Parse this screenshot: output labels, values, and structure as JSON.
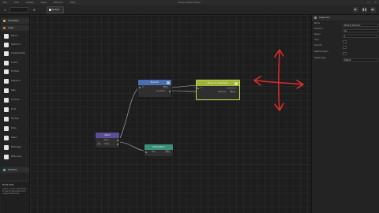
{
  "window": {
    "title": "Node Graph Editor",
    "menu": [
      "File",
      "Edit",
      "Assets",
      "View",
      "Window",
      "Help"
    ],
    "controls": [
      "–",
      "□",
      "✕"
    ]
  },
  "toolbar": {
    "graph_tab_label": "Graph",
    "play_icons": [
      "▶",
      "❚❚",
      "▶|"
    ]
  },
  "left_panel": {
    "categories": [
      {
        "label": "Variables",
        "color": "#c8b05a"
      },
      {
        "label": "Logic",
        "color": "#d07b38"
      },
      {
        "label": "Utilities",
        "color": "#5ea3c8"
      }
    ],
    "nodes": [
      {
        "label": "Branch"
      },
      {
        "label": "Switch Int"
      },
      {
        "label": "Compare Float"
      },
      {
        "label": "Is Valid"
      },
      {
        "label": "For Each"
      },
      {
        "label": "Sequence"
      },
      {
        "label": "Gate"
      },
      {
        "label": "Do Once"
      },
      {
        "label": "Do N"
      },
      {
        "label": "Flip Flop"
      },
      {
        "label": "Delay"
      },
      {
        "label": "Select"
      },
      {
        "label": "Multi Gate"
      },
      {
        "label": "While Loop"
      }
    ],
    "help": {
      "title": "Node Help",
      "text": "Select a node in the graph to see its description and usage details here."
    }
  },
  "graph": {
    "nodes": {
      "start": {
        "title": "Start",
        "color": "#5b4e96",
        "rows": [
          "Exec",
          "Value"
        ],
        "field": "0"
      },
      "branch": {
        "title": "Branch",
        "color": "#4a6fb0",
        "rows": [
          "In",
          "Condition"
        ],
        "field": "true"
      },
      "move": {
        "title": "Move to Direction",
        "color": "#9fb33a",
        "rows": [
          "In",
          "Direction"
        ],
        "field": "Up"
      },
      "animation": {
        "title": "Animation",
        "color": "#3b8f7a",
        "rows": [
          "Play"
        ],
        "field": "Idle"
      }
    }
  },
  "inspector": {
    "title": "Inspector",
    "properties": [
      {
        "label": "Name",
        "value": "Move to Direction",
        "type": "text"
      },
      {
        "label": "Direction",
        "value": "Up",
        "type": "dropdown"
      },
      {
        "label": "Speed",
        "value": "1",
        "type": "text"
      },
      {
        "label": "Loop",
        "value": "",
        "type": "check"
      },
      {
        "label": "Smooth",
        "value": "",
        "type": "check"
      },
      {
        "label": "Relative Space",
        "value": "",
        "type": "check"
      },
      {
        "label": "Target Layer",
        "value": "Default",
        "type": "text"
      }
    ]
  }
}
